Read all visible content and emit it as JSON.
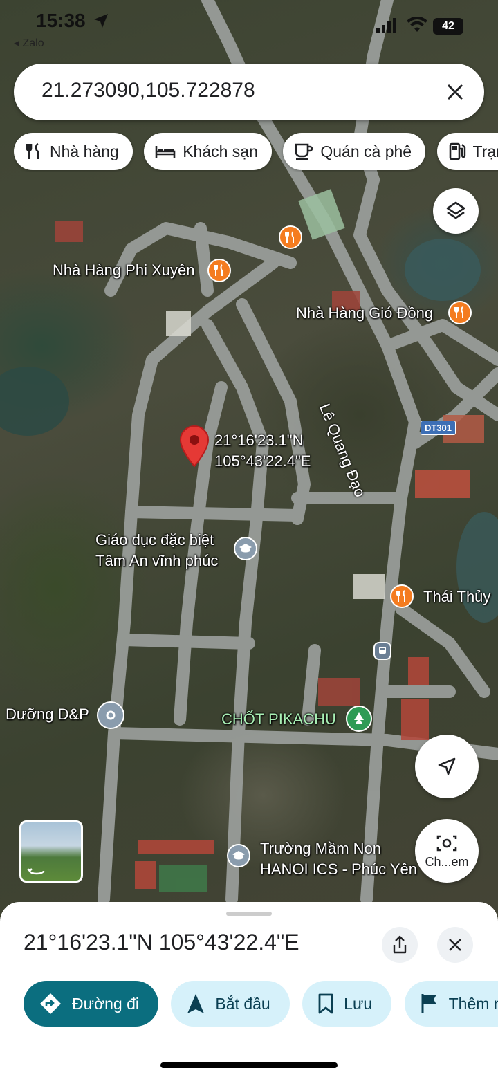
{
  "status_bar": {
    "time": "15:38",
    "back_app": "◂ Zalo",
    "battery": "42"
  },
  "search": {
    "query": "21.273090,105.722878"
  },
  "chips": [
    {
      "label": "Nhà hàng",
      "icon": "fork-knife-icon"
    },
    {
      "label": "Khách sạn",
      "icon": "bed-icon"
    },
    {
      "label": "Quán cà phê",
      "icon": "coffee-cup-icon"
    },
    {
      "label": "Trạm",
      "icon": "gas-station-icon"
    }
  ],
  "map": {
    "pin_coords": [
      "21°16'23.1\"N",
      "105°43'22.4\"E"
    ],
    "road_shield": "DT301",
    "road_name": "Lê Quang Đạo",
    "places": {
      "phi_xuyen": "Nhà Hàng Phi Xuyên",
      "gio_dong": "Nhà Hàng Gió Đồng",
      "giao_duc": [
        "Giáo dục đặc biệt",
        "Tâm An vĩnh phúc"
      ],
      "thai_thuy": "Thái Thủy",
      "duong_dp": "Dưỡng D&P",
      "pikachu": "CHỐT PIKACHU",
      "mam_non": [
        "Trường Mầm Non",
        "HANOI ICS - Phúc Yên"
      ],
      "camera_label": "Ch...em"
    }
  },
  "sheet": {
    "title": "21°16'23.1\"N 105°43'22.4\"E",
    "actions": [
      {
        "label": "Đường đi",
        "icon": "directions-icon"
      },
      {
        "label": "Bắt đầu",
        "icon": "navigation-arrow-icon"
      },
      {
        "label": "Lưu",
        "icon": "bookmark-icon"
      },
      {
        "label": "Thêm nhãn",
        "icon": "flag-icon"
      }
    ]
  },
  "colors": {
    "primary_action": "#0b6e7f",
    "secondary_action": "#d6f1fa",
    "pin_red": "#e53935",
    "food_orange": "#f47c20"
  }
}
